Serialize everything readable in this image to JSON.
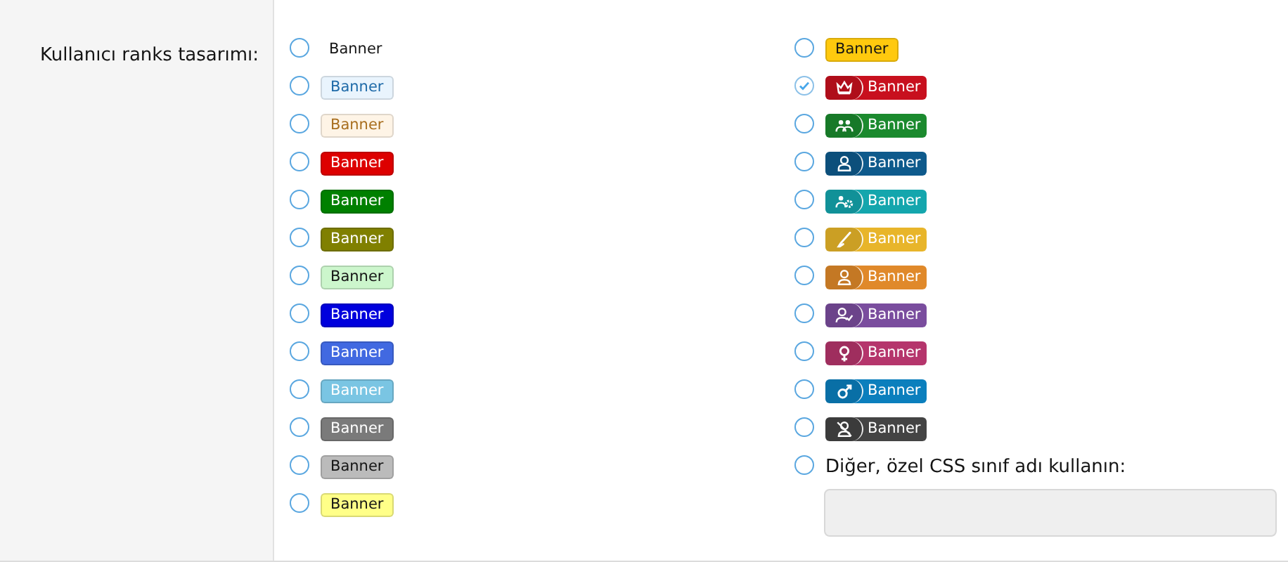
{
  "label": "Kullanıcı ranks tasarımı:",
  "columns": [
    [
      {
        "kind": "plain",
        "text": "Banner",
        "selected": false
      },
      {
        "kind": "light",
        "text": "Banner",
        "color": "#e9f4fd",
        "selected": false
      },
      {
        "kind": "light",
        "text": "Banner",
        "color": "#fef4e6",
        "selected": false
      },
      {
        "kind": "solid",
        "text": "Banner",
        "color": "#dd0000",
        "selected": false
      },
      {
        "kind": "solid",
        "text": "Banner",
        "color": "#008000",
        "selected": false
      },
      {
        "kind": "solid",
        "text": "Banner",
        "color": "#808000",
        "selected": false
      },
      {
        "kind": "pale",
        "text": "Banner",
        "color": "#ccf6cc",
        "selected": false
      },
      {
        "kind": "solid",
        "text": "Banner",
        "color": "#0000dd",
        "selected": false
      },
      {
        "kind": "solid",
        "text": "Banner",
        "color": "#4169e1",
        "selected": false
      },
      {
        "kind": "solid",
        "text": "Banner",
        "color": "#7ac5e3",
        "selected": false
      },
      {
        "kind": "solid",
        "text": "Banner",
        "color": "#7a7a7a",
        "selected": false
      },
      {
        "kind": "pale",
        "text": "Banner",
        "color": "#bbbbbb",
        "selected": false
      },
      {
        "kind": "pale",
        "text": "Banner",
        "color": "#ffff88",
        "selected": false
      }
    ],
    [
      {
        "kind": "pale",
        "text": "Banner",
        "color": "#ffc90e",
        "selected": false
      },
      {
        "kind": "icon",
        "text": "Banner",
        "color": "#c8101e",
        "selected": true
      },
      {
        "kind": "icon",
        "text": "Banner",
        "color": "#1b8a2e",
        "selected": false
      },
      {
        "kind": "icon",
        "text": "Banner",
        "color": "#0e5a8c",
        "selected": false
      },
      {
        "kind": "icon",
        "text": "Banner",
        "color": "#14a6ad",
        "selected": false
      },
      {
        "kind": "icon",
        "text": "Banner",
        "color": "#e8b52a",
        "selected": false
      },
      {
        "kind": "icon",
        "text": "Banner",
        "color": "#e0892a",
        "selected": false
      },
      {
        "kind": "icon",
        "text": "Banner",
        "color": "#7a4d9e",
        "selected": false
      },
      {
        "kind": "icon",
        "text": "Banner",
        "color": "#b5356c",
        "selected": false
      },
      {
        "kind": "icon",
        "text": "Banner",
        "color": "#0b7fbd",
        "selected": false
      },
      {
        "kind": "icon",
        "text": "Banner",
        "color": "#444444",
        "selected": false
      },
      {
        "kind": "custom",
        "text": "Diğer, özel CSS sınıf adı kullanın:",
        "selected": false,
        "disabled": true
      }
    ]
  ]
}
